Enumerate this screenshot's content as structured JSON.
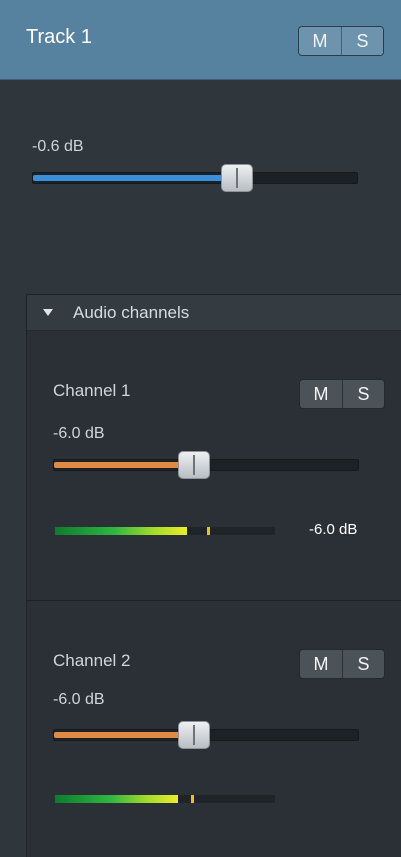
{
  "track": {
    "title": "Track 1",
    "mute_label": "M",
    "solo_label": "S",
    "volume_label": "-0.6 dB",
    "volume_fraction": 0.63
  },
  "audio_channels": {
    "title": "Audio channels",
    "channels": [
      {
        "name": "Channel 1",
        "mute_label": "M",
        "solo_label": "S",
        "volume_label": "-6.0 dB",
        "volume_fraction": 0.46,
        "meter_level_fraction": 0.6,
        "meter_peak_fraction": 0.69,
        "meter_readout": "-6.0 dB"
      },
      {
        "name": "Channel 2",
        "mute_label": "M",
        "solo_label": "S",
        "volume_label": "-6.0 dB",
        "volume_fraction": 0.46,
        "meter_level_fraction": 0.56,
        "meter_peak_fraction": 0.62
      }
    ]
  },
  "colors": {
    "header_bg": "#56819f",
    "master_fill": "#3a8fd8",
    "channel_fill": "#e08a45",
    "meter_green": "#2fb640",
    "meter_yellow": "#ecec2a",
    "panel_bg": "#2f363c"
  }
}
